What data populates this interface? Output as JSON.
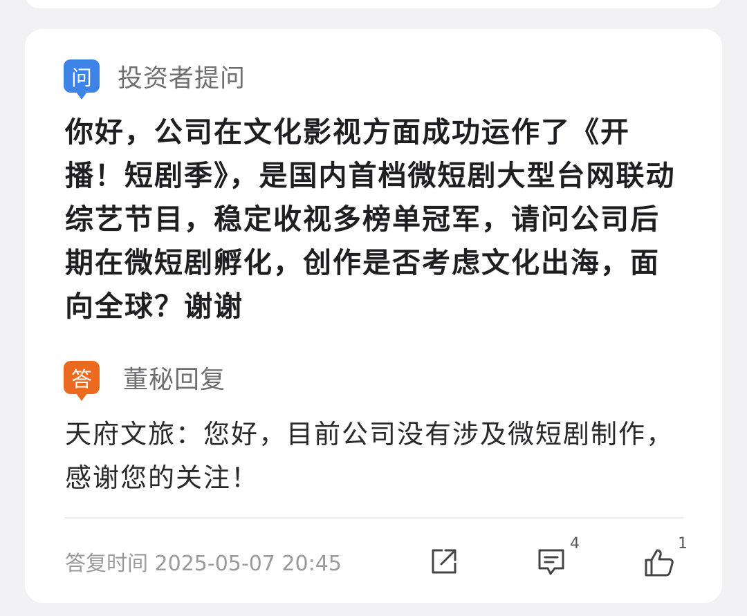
{
  "question": {
    "badge": "问",
    "label": "投资者提问",
    "text": "你好，公司在文化影视方面成功运作了《开播！短剧季》，是国内首档微短剧大型台网联动综艺节目，稳定收视多榜单冠军，请问公司后期在微短剧孵化，创作是否考虑文化出海，面向全球？谢谢"
  },
  "answer": {
    "badge": "答",
    "label": "董秘回复",
    "text": "天府文旅：您好，目前公司没有涉及微短剧制作，感谢您的关注！"
  },
  "footer": {
    "reply_time": "答复时间 2025-05-07 20:45",
    "comment_count": "4",
    "like_count": "1",
    "icons": [
      "share-icon",
      "comment-icon",
      "like-icon"
    ]
  },
  "colors": {
    "question_badge": "#3d84e6",
    "answer_badge": "#ec6a1f",
    "background": "#f2f2f4"
  }
}
